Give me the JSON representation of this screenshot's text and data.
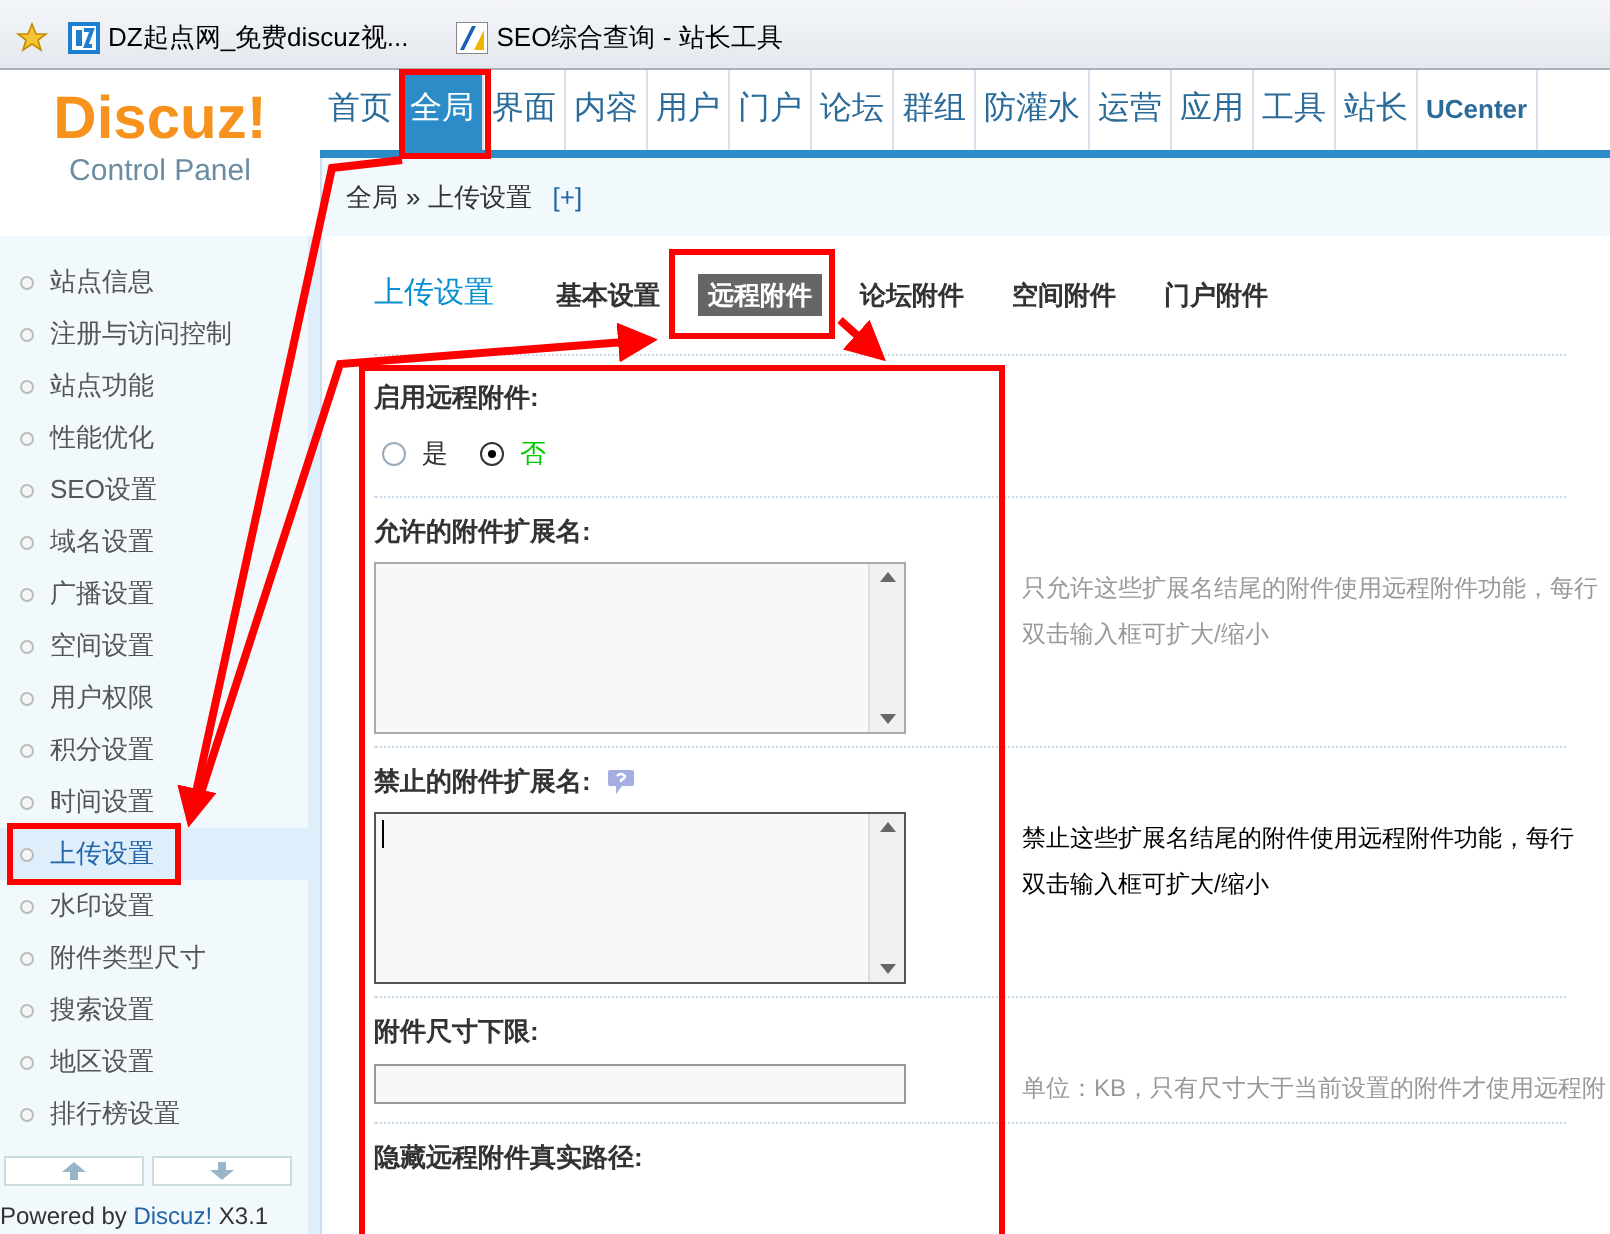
{
  "bookmarks": [
    {
      "label": "DZ起点网_免费discuz视..."
    },
    {
      "label": "SEO综合查询 - 站长工具"
    }
  ],
  "logo": {
    "title": "Discuz!",
    "subtitle": "Control Panel"
  },
  "nav": [
    {
      "label": "首页",
      "selected": false
    },
    {
      "label": "全局",
      "selected": true
    },
    {
      "label": "界面",
      "selected": false
    },
    {
      "label": "内容",
      "selected": false
    },
    {
      "label": "用户",
      "selected": false
    },
    {
      "label": "门户",
      "selected": false
    },
    {
      "label": "论坛",
      "selected": false
    },
    {
      "label": "群组",
      "selected": false
    },
    {
      "label": "防灌水",
      "selected": false
    },
    {
      "label": "运营",
      "selected": false
    },
    {
      "label": "应用",
      "selected": false
    },
    {
      "label": "工具",
      "selected": false
    },
    {
      "label": "站长",
      "selected": false
    },
    {
      "label": "UCenter",
      "selected": false
    }
  ],
  "breadcrumb": {
    "parts": [
      "全局",
      "»",
      "上传设置"
    ],
    "add": "[+]"
  },
  "sidebar": {
    "items": [
      {
        "label": "站点信息",
        "selected": false
      },
      {
        "label": "注册与访问控制",
        "selected": false
      },
      {
        "label": "站点功能",
        "selected": false
      },
      {
        "label": "性能优化",
        "selected": false
      },
      {
        "label": "SEO设置",
        "selected": false
      },
      {
        "label": "域名设置",
        "selected": false
      },
      {
        "label": "广播设置",
        "selected": false
      },
      {
        "label": "空间设置",
        "selected": false
      },
      {
        "label": "用户权限",
        "selected": false
      },
      {
        "label": "积分设置",
        "selected": false
      },
      {
        "label": "时间设置",
        "selected": false
      },
      {
        "label": "上传设置",
        "selected": true
      },
      {
        "label": "水印设置",
        "selected": false
      },
      {
        "label": "附件类型尺寸",
        "selected": false
      },
      {
        "label": "搜索设置",
        "selected": false
      },
      {
        "label": "地区设置",
        "selected": false
      },
      {
        "label": "排行榜设置",
        "selected": false
      }
    ],
    "footer": {
      "prefix": "Powered by",
      "brand": "Discuz!",
      "version": "X3.1"
    }
  },
  "page": {
    "title": "上传设置",
    "tabs": [
      {
        "label": "基本设置",
        "selected": false
      },
      {
        "label": "远程附件",
        "selected": true
      },
      {
        "label": "论坛附件",
        "selected": false
      },
      {
        "label": "空间附件",
        "selected": false
      },
      {
        "label": "门户附件",
        "selected": false
      }
    ]
  },
  "settings": [
    {
      "kind": "radio",
      "label": "启用远程附件:",
      "options": [
        {
          "label": "是",
          "selected": false
        },
        {
          "label": "否",
          "selected": true
        }
      ]
    },
    {
      "kind": "textarea",
      "label": "允许的附件扩展名:",
      "focused": false,
      "hint": [
        "只允许这些扩展名结尾的附件使用远程附件功能，每行",
        "双击输入框可扩大/缩小"
      ]
    },
    {
      "kind": "textarea",
      "label": "禁止的附件扩展名:",
      "help": true,
      "focused": true,
      "hint": [
        "禁止这些扩展名结尾的附件使用远程附件功能，每行",
        "双击输入框可扩大/缩小"
      ]
    },
    {
      "kind": "input",
      "label": "附件尺寸下限:",
      "hint": [
        "单位：KB，只有尺寸大于当前设置的附件才使用远程附"
      ]
    },
    {
      "kind": "label",
      "label": "隐藏远程附件真实路径:"
    }
  ]
}
